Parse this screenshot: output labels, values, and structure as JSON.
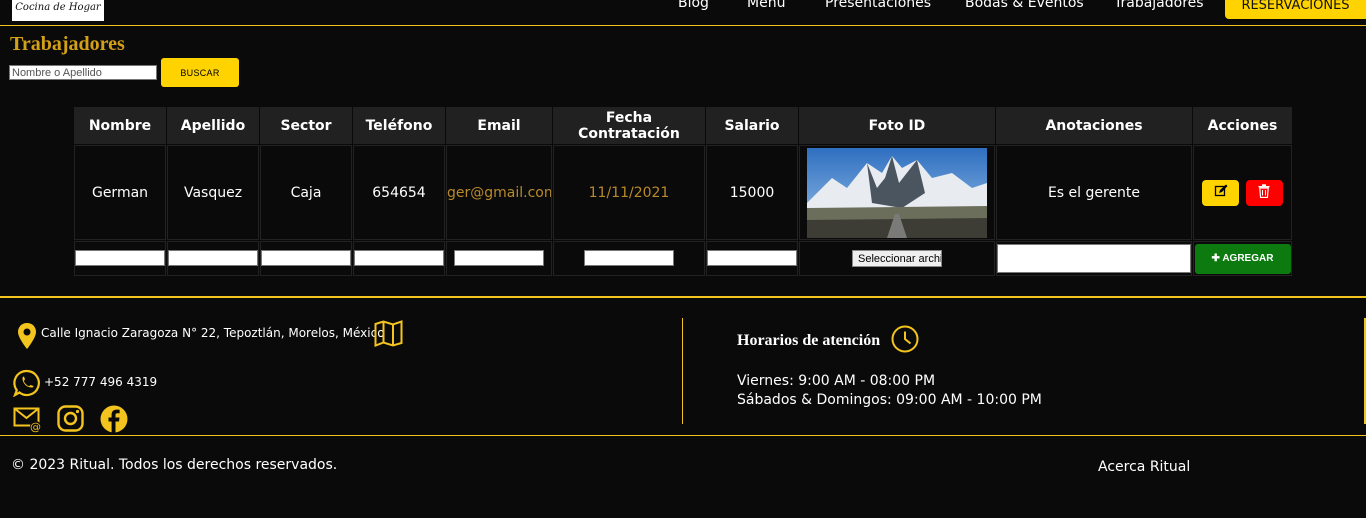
{
  "nav": {
    "logo_text": "Cocina de Hogar",
    "links": [
      "Blog",
      "Menú",
      "Presentaciones",
      "Bodas & Eventos",
      "Trabajadores"
    ],
    "reserve_label": "RESERVACIONES"
  },
  "page": {
    "title": "Trabajadores",
    "search_placeholder": "Nombre o Apellido",
    "search_button": "BUSCAR"
  },
  "table": {
    "headers": [
      "Nombre",
      "Apellido",
      "Sector",
      "Teléfono",
      "Email",
      "Fecha Contratación",
      "Salario",
      "Foto ID",
      "Anotaciones",
      "Acciones"
    ],
    "rows": [
      {
        "nombre": "German",
        "apellido": "Vasquez",
        "sector": "Caja",
        "telefono": "654654",
        "email": "ger@gmail.com",
        "fecha": "11/11/2021",
        "salario": "15000",
        "anotaciones": "Es el gerente"
      }
    ],
    "file_button": "Seleccionar archivo",
    "add_button": "AGREGAR"
  },
  "footer": {
    "address": "Calle Ignacio Zaragoza N° 22, Tepoztlán, Morelos, México",
    "phone": "+52 777 496 4319",
    "hours_title": "Horarios de atención",
    "hours": [
      "Viernes: 9:00 AM - 08:00 PM",
      "Sábados & Domingos: 09:00 AM - 10:00 PM"
    ],
    "copyright": "© 2023 Ritual. Todos los derechos reservados.",
    "about": "Acerca Ritual"
  },
  "colors": {
    "accent": "#ffd300",
    "title_gold": "#d4a017",
    "delete": "#ff0000",
    "add": "#0c7a0f",
    "background": "#0b0a0a"
  },
  "icons": [
    "location-pin-icon",
    "map-icon",
    "whatsapp-icon",
    "email-icon",
    "instagram-icon",
    "facebook-icon",
    "clock-icon",
    "edit-icon",
    "trash-icon",
    "plus-icon"
  ]
}
